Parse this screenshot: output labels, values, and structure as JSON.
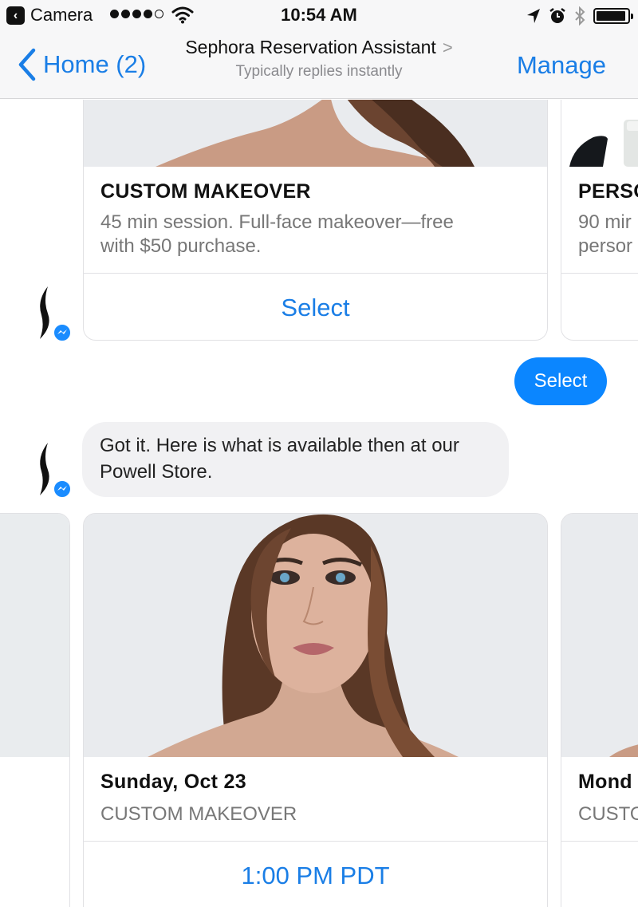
{
  "status_bar": {
    "back_app": "Camera",
    "signal_bars": 4,
    "signal_total": 5,
    "time": "10:54 AM",
    "battery_level": 0.95,
    "icons": [
      "wifi-icon",
      "location-arrow-icon",
      "alarm-icon",
      "bluetooth-icon",
      "battery-icon"
    ]
  },
  "nav": {
    "back_label": "Home (2)",
    "title": "Sephora Reservation Assistant",
    "subtitle": "Typically replies instantly",
    "manage_label": "Manage"
  },
  "services_carousel": {
    "cards": [
      {
        "title": "CUSTOM MAKEOVER",
        "description_line1": "45 min session. Full-face makeover—free",
        "description_line2": "with $50 purchase.",
        "button_label": "Select"
      },
      {
        "title": "PERSO",
        "description_line1": "90 mir",
        "description_line2": "persor"
      }
    ]
  },
  "user_reply": {
    "text": "Select"
  },
  "bot_message": {
    "line1": "Got it. Here is what is available then at our",
    "line2": "Powell Store."
  },
  "slots_carousel": {
    "cards": [
      {
        "date": "Sunday, Oct 23",
        "service": "CUSTOM MAKEOVER",
        "button_label": "1:00 PM PDT"
      },
      {
        "date": "Mond",
        "service": "CUSTO"
      }
    ]
  },
  "colors": {
    "accent": "#1a7ee6",
    "bubble_user": "#0b86ff",
    "bubble_bot": "#f1f1f3",
    "nav_bg": "#f7f7f8"
  }
}
